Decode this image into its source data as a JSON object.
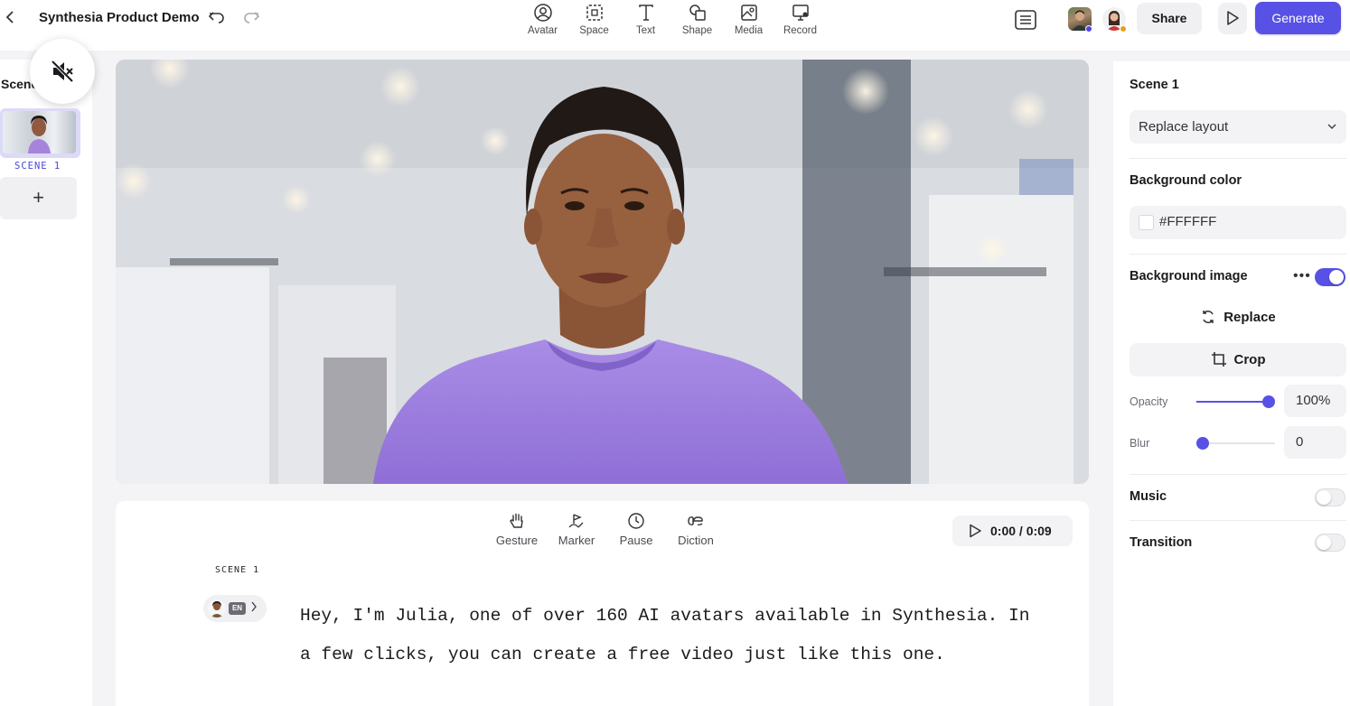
{
  "header": {
    "back_icon": "chevron-left-icon",
    "project_title": "Synthesia Product Demo",
    "tools": [
      {
        "label": "Avatar",
        "icon": "avatar-icon"
      },
      {
        "label": "Space",
        "icon": "space-icon"
      },
      {
        "label": "Text",
        "icon": "text-icon"
      },
      {
        "label": "Shape",
        "icon": "shape-icon"
      },
      {
        "label": "Media",
        "icon": "media-icon"
      },
      {
        "label": "Record",
        "icon": "record-icon"
      }
    ],
    "share_label": "Share",
    "generate_label": "Generate",
    "accent_color": "#5751e6"
  },
  "sidebar": {
    "title": "Scenes",
    "scenes": [
      {
        "label": "SCENE 1"
      }
    ],
    "add_label": "+"
  },
  "script": {
    "tools": [
      {
        "label": "Gesture",
        "icon": "hand-icon"
      },
      {
        "label": "Marker",
        "icon": "marker-icon"
      },
      {
        "label": "Pause",
        "icon": "clock-icon"
      },
      {
        "label": "Diction",
        "icon": "diction-icon"
      }
    ],
    "time": "0:00 / 0:09",
    "scene_label": "SCENE 1",
    "language": "EN",
    "text": "Hey, I'm Julia, one of over 160 AI avatars available in Synthesia. In a few clicks, you can create a free video just like this one."
  },
  "panel": {
    "scene_title": "Scene 1",
    "layout_select": "Replace layout",
    "background_color_label": "Background color",
    "background_color_value": "#FFFFFF",
    "background_image_label": "Background image",
    "background_image_enabled": true,
    "replace_label": "Replace",
    "crop_label": "Crop",
    "opacity_label": "Opacity",
    "opacity_value": "100%",
    "opacity_level": 1.0,
    "blur_label": "Blur",
    "blur_value": "0",
    "blur_level": 0,
    "music_label": "Music",
    "music_enabled": false,
    "transition_label": "Transition",
    "transition_enabled": false
  }
}
